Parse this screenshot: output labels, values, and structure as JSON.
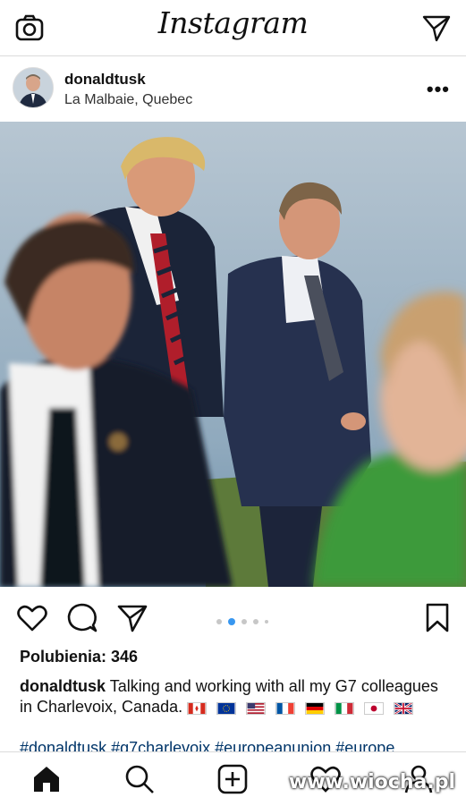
{
  "app": {
    "title": "Instagram"
  },
  "post": {
    "username": "donaldtusk",
    "location": "La Malbaie, Quebec",
    "likes_text": "Polubienia: 346",
    "caption_user": "donaldtusk",
    "caption_text": "Talking and working with all my G7 colleagues in Charlevoix, Canada.",
    "hashtags": "#donaldtusk #g7charlevoix #europeanunion #europe",
    "carousel": {
      "count": 5,
      "active": 2
    }
  },
  "flags": [
    "canada-flag",
    "eu-flag",
    "usa-flag",
    "france-flag",
    "germany-flag",
    "italy-flag",
    "japan-flag",
    "uk-flag"
  ],
  "icons": {
    "camera": "camera-icon",
    "direct": "send-icon",
    "more": "more-icon",
    "like": "heart-icon",
    "comment": "comment-icon",
    "share": "share-icon",
    "save": "bookmark-icon",
    "home": "home-icon",
    "search": "search-icon",
    "add": "add-icon",
    "activity": "heart-icon",
    "profile": "profile-icon"
  },
  "more_label": "•••",
  "watermark": "www.wiocha.pl",
  "colors": {
    "accent": "#3897f0",
    "hashtag": "#003569"
  }
}
